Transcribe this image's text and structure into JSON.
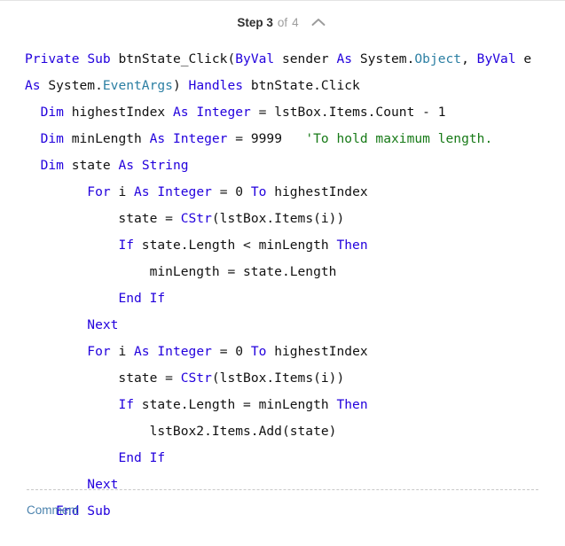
{
  "header": {
    "step_label": "Step 3",
    "of_label": "of",
    "total_label": "4",
    "collapse_icon": "chevron-up-icon"
  },
  "footer": {
    "comment_label": "Comment"
  },
  "colors": {
    "keyword": "#2200dd",
    "type": "#2c7fa3",
    "comment": "#177a17",
    "text": "#111111",
    "link": "#4a82ad",
    "divider": "#c9c9c9",
    "step_label": "#2f2f2f",
    "step_muted": "#9d9d9d"
  },
  "code": {
    "language": "Visual Basic .NET",
    "plain_text": "Private Sub btnState_Click(ByVal sender As System.Object, ByVal e\nAs System.EventArgs) Handles btnState.Click\n  Dim highestIndex As Integer = lstBox.Items.Count - 1\n  Dim minLength As Integer = 9999   'To hold maximum length.\n  Dim state As String\n        For i As Integer = 0 To highestIndex\n            state = CStr(lstBox.Items(i))\n            If state.Length < minLength Then\n                minLength = state.Length\n            End If\n        Next\n        For i As Integer = 0 To highestIndex\n            state = CStr(lstBox.Items(i))\n            If state.Length = minLength Then\n                lstBox2.Items.Add(state)\n            End If\n        Next\n    End Sub",
    "lines": [
      [
        {
          "t": "Private",
          "c": "kw"
        },
        {
          "t": " ",
          "c": "txt"
        },
        {
          "t": "Sub",
          "c": "kw"
        },
        {
          "t": " btnState_Click(",
          "c": "txt"
        },
        {
          "t": "ByVal",
          "c": "kw"
        },
        {
          "t": " sender ",
          "c": "txt"
        },
        {
          "t": "As",
          "c": "kw"
        },
        {
          "t": " System.",
          "c": "txt"
        },
        {
          "t": "Object",
          "c": "type"
        },
        {
          "t": ", ",
          "c": "txt"
        },
        {
          "t": "ByVal",
          "c": "kw"
        },
        {
          "t": " e",
          "c": "txt"
        }
      ],
      [
        {
          "t": "As",
          "c": "kw"
        },
        {
          "t": " System.",
          "c": "txt"
        },
        {
          "t": "EventArgs",
          "c": "type"
        },
        {
          "t": ") ",
          "c": "txt"
        },
        {
          "t": "Handles",
          "c": "kw"
        },
        {
          "t": " btnState.Click",
          "c": "txt"
        }
      ],
      [
        {
          "t": "  ",
          "c": "txt"
        },
        {
          "t": "Dim",
          "c": "kw"
        },
        {
          "t": " highestIndex ",
          "c": "txt"
        },
        {
          "t": "As",
          "c": "kw"
        },
        {
          "t": " ",
          "c": "txt"
        },
        {
          "t": "Integer",
          "c": "kw"
        },
        {
          "t": " = lstBox.Items.Count - ",
          "c": "txt"
        },
        {
          "t": "1",
          "c": "num"
        }
      ],
      [
        {
          "t": "  ",
          "c": "txt"
        },
        {
          "t": "Dim",
          "c": "kw"
        },
        {
          "t": " minLength ",
          "c": "txt"
        },
        {
          "t": "As",
          "c": "kw"
        },
        {
          "t": " ",
          "c": "txt"
        },
        {
          "t": "Integer",
          "c": "kw"
        },
        {
          "t": " = ",
          "c": "txt"
        },
        {
          "t": "9999",
          "c": "num"
        },
        {
          "t": "   ",
          "c": "txt"
        },
        {
          "t": "'To hold maximum length.",
          "c": "cmt"
        }
      ],
      [
        {
          "t": "  ",
          "c": "txt"
        },
        {
          "t": "Dim",
          "c": "kw"
        },
        {
          "t": " state ",
          "c": "txt"
        },
        {
          "t": "As",
          "c": "kw"
        },
        {
          "t": " ",
          "c": "txt"
        },
        {
          "t": "String",
          "c": "kw"
        }
      ],
      [
        {
          "t": "        ",
          "c": "txt"
        },
        {
          "t": "For",
          "c": "kw"
        },
        {
          "t": " i ",
          "c": "txt"
        },
        {
          "t": "As",
          "c": "kw"
        },
        {
          "t": " ",
          "c": "txt"
        },
        {
          "t": "Integer",
          "c": "kw"
        },
        {
          "t": " = ",
          "c": "txt"
        },
        {
          "t": "0",
          "c": "num"
        },
        {
          "t": " ",
          "c": "txt"
        },
        {
          "t": "To",
          "c": "kw"
        },
        {
          "t": " highestIndex",
          "c": "txt"
        }
      ],
      [
        {
          "t": "            state = ",
          "c": "txt"
        },
        {
          "t": "CStr",
          "c": "kw"
        },
        {
          "t": "(lstBox.Items(i))",
          "c": "txt"
        }
      ],
      [
        {
          "t": "            ",
          "c": "txt"
        },
        {
          "t": "If",
          "c": "kw"
        },
        {
          "t": " state.Length < minLength ",
          "c": "txt"
        },
        {
          "t": "Then",
          "c": "kw"
        }
      ],
      [
        {
          "t": "                minLength = state.Length",
          "c": "txt"
        }
      ],
      [
        {
          "t": "            ",
          "c": "txt"
        },
        {
          "t": "End If",
          "c": "kw"
        }
      ],
      [
        {
          "t": "        ",
          "c": "txt"
        },
        {
          "t": "Next",
          "c": "kw"
        }
      ],
      [
        {
          "t": "        ",
          "c": "txt"
        },
        {
          "t": "For",
          "c": "kw"
        },
        {
          "t": " i ",
          "c": "txt"
        },
        {
          "t": "As",
          "c": "kw"
        },
        {
          "t": " ",
          "c": "txt"
        },
        {
          "t": "Integer",
          "c": "kw"
        },
        {
          "t": " = ",
          "c": "txt"
        },
        {
          "t": "0",
          "c": "num"
        },
        {
          "t": " ",
          "c": "txt"
        },
        {
          "t": "To",
          "c": "kw"
        },
        {
          "t": " highestIndex",
          "c": "txt"
        }
      ],
      [
        {
          "t": "            state = ",
          "c": "txt"
        },
        {
          "t": "CStr",
          "c": "kw"
        },
        {
          "t": "(lstBox.Items(i))",
          "c": "txt"
        }
      ],
      [
        {
          "t": "            ",
          "c": "txt"
        },
        {
          "t": "If",
          "c": "kw"
        },
        {
          "t": " state.Length = minLength ",
          "c": "txt"
        },
        {
          "t": "Then",
          "c": "kw"
        }
      ],
      [
        {
          "t": "                lstBox2.Items.Add(state)",
          "c": "txt"
        }
      ],
      [
        {
          "t": "            ",
          "c": "txt"
        },
        {
          "t": "End If",
          "c": "kw"
        }
      ],
      [
        {
          "t": "        ",
          "c": "txt"
        },
        {
          "t": "Next",
          "c": "kw"
        }
      ],
      [
        {
          "t": "    ",
          "c": "txt"
        },
        {
          "t": "End Sub",
          "c": "kw"
        }
      ]
    ]
  }
}
